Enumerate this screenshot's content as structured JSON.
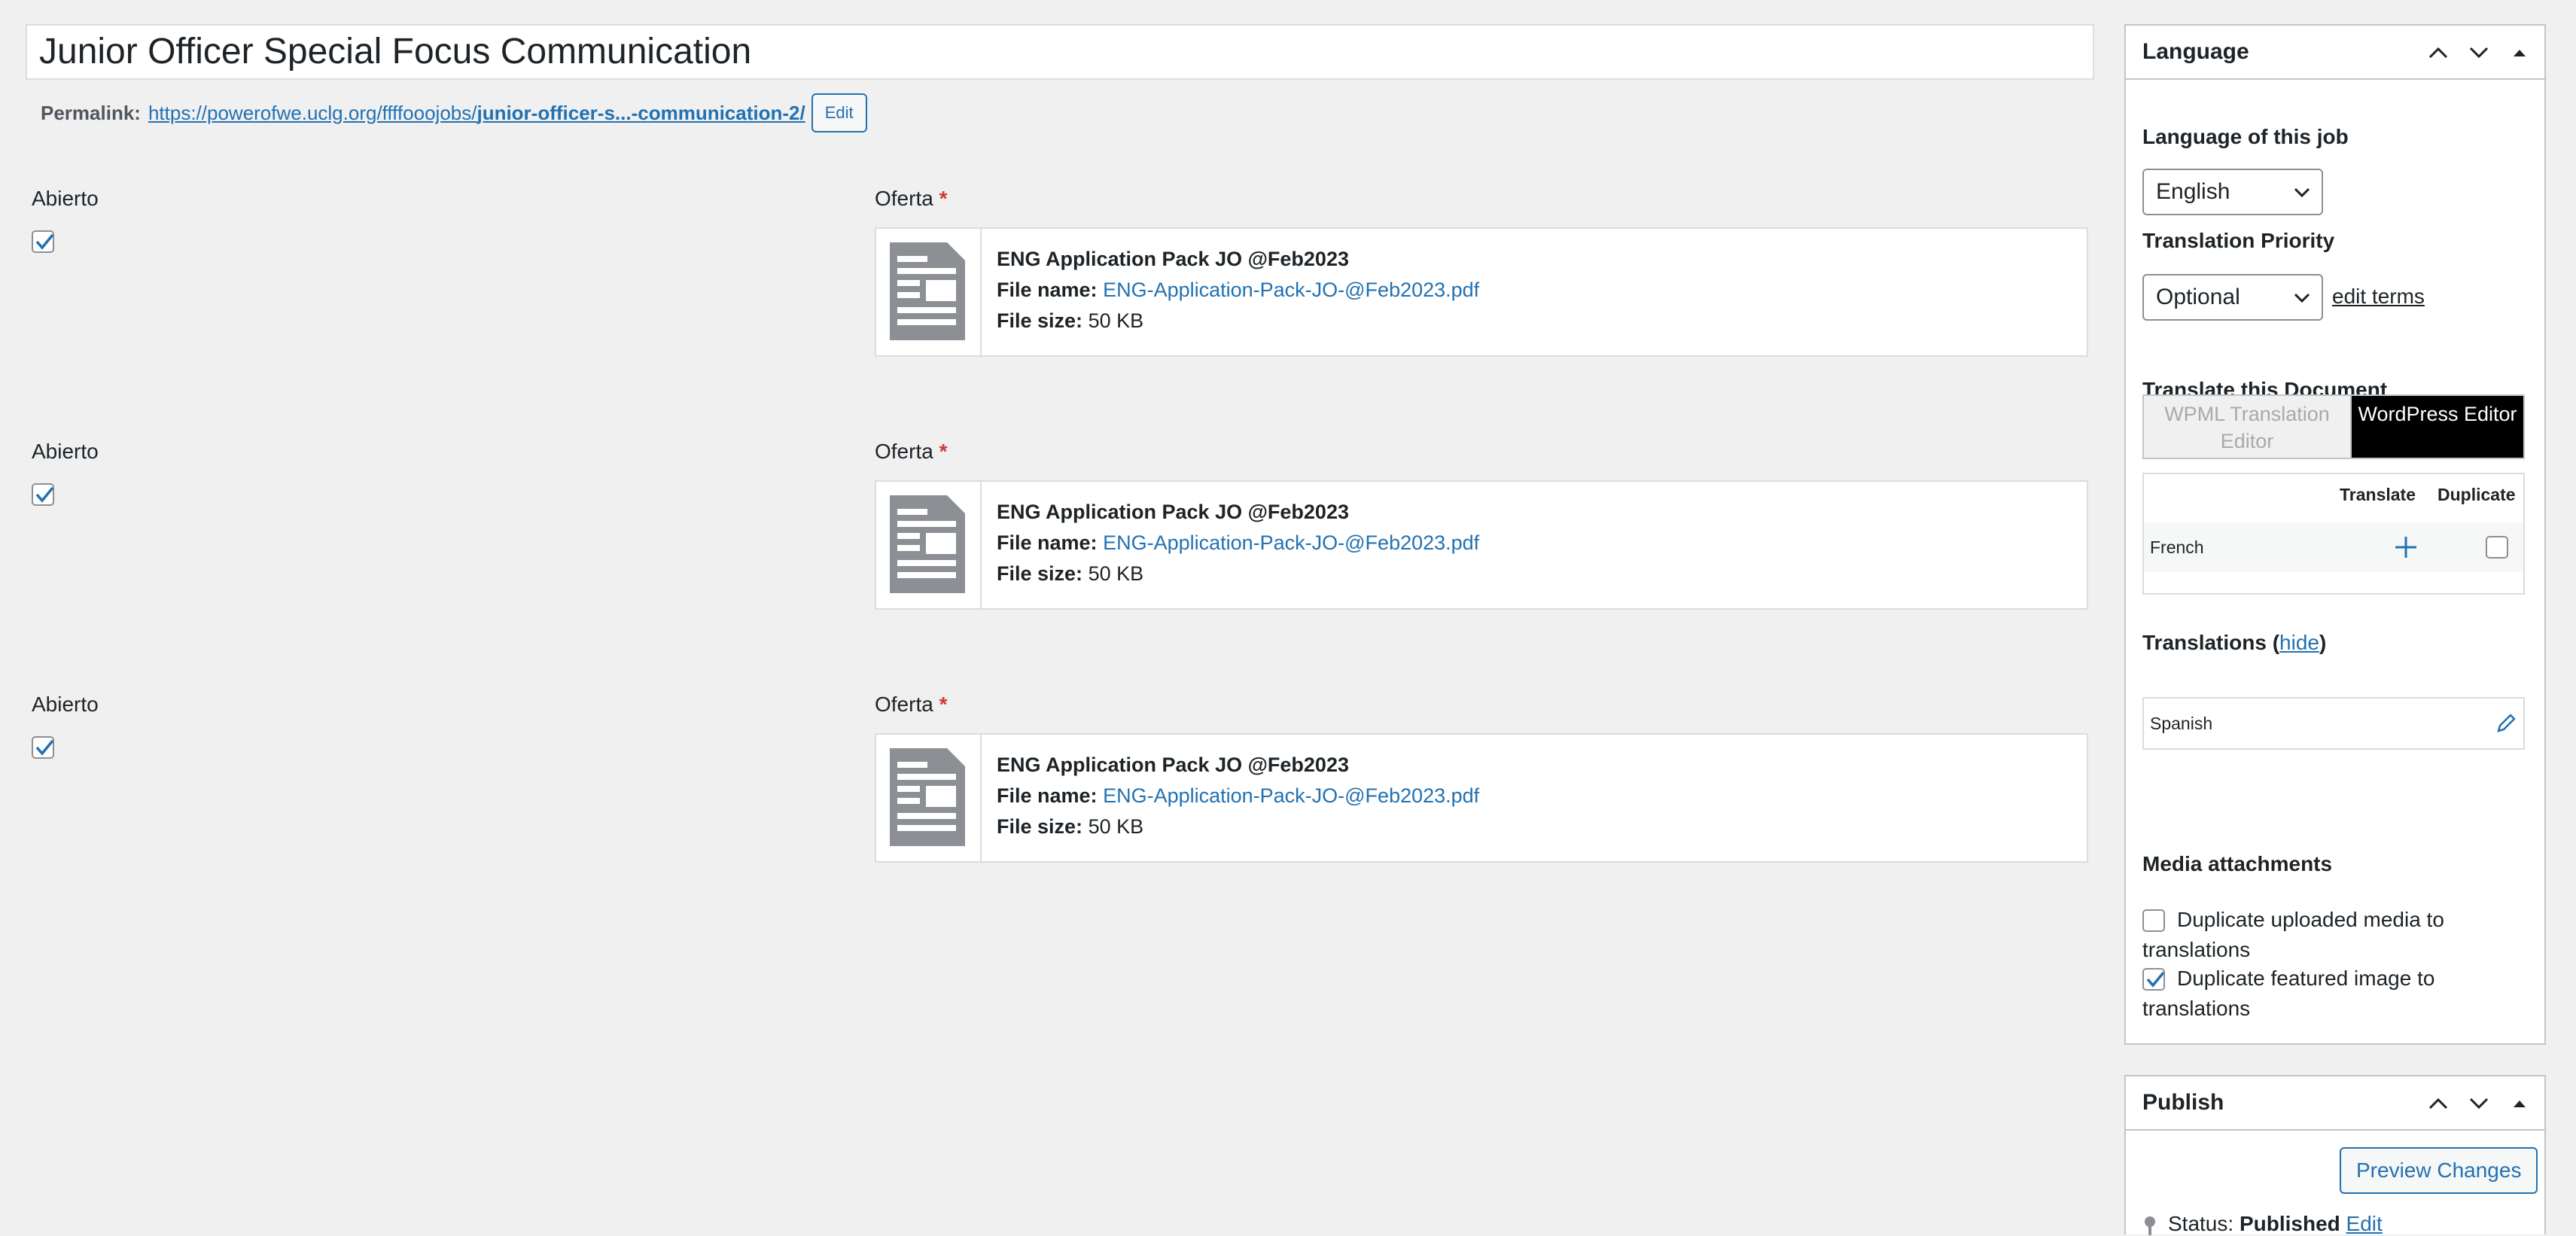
{
  "post": {
    "title": "Junior Officer Special Focus Communication",
    "permalink_label": "Permalink:",
    "permalink_base": "https://powerofwe.uclg.org/ffffooojobs/",
    "permalink_slug": "junior-officer-s...-communication-2/",
    "edit_button": "Edit"
  },
  "rows": [
    {
      "checkbox_label": "Abierto",
      "checked": true,
      "file_label": "Oferta",
      "required_mark": "*",
      "file_title": "ENG Application Pack JO @Feb2023",
      "file_name_label": "File name:",
      "file_name": "ENG-Application-Pack-JO-@Feb2023.pdf",
      "file_size_label": "File size:",
      "file_size": "50 KB"
    },
    {
      "checkbox_label": "Abierto",
      "checked": true,
      "file_label": "Oferta",
      "required_mark": "*",
      "file_title": "ENG Application Pack JO @Feb2023",
      "file_name_label": "File name:",
      "file_name": "ENG-Application-Pack-JO-@Feb2023.pdf",
      "file_size_label": "File size:",
      "file_size": "50 KB"
    },
    {
      "checkbox_label": "Abierto",
      "checked": true,
      "file_label": "Oferta",
      "required_mark": "*",
      "file_title": "ENG Application Pack JO @Feb2023",
      "file_name_label": "File name:",
      "file_name": "ENG-Application-Pack-JO-@Feb2023.pdf",
      "file_size_label": "File size:",
      "file_size": "50 KB"
    }
  ],
  "language_box": {
    "title": "Language",
    "language_of_job_label": "Language of this job",
    "language_value": "English",
    "priority_label": "Translation Priority",
    "priority_value": "Optional",
    "edit_terms": "edit terms",
    "translate_doc_label": "Translate this Document",
    "option_wpml": "WPML Translation Editor",
    "option_wp": "WordPress Editor",
    "col_translate": "Translate",
    "col_duplicate": "Duplicate",
    "target_language": "French",
    "translations_label": "Translations (",
    "translations_hide": "hide",
    "translations_close": ")",
    "existing_translation": "Spanish",
    "media_label": "Media attachments",
    "dup_media": "Duplicate uploaded media to translations",
    "dup_media_checked": false,
    "dup_featured": "Duplicate featured image to translations",
    "dup_featured_checked": true
  },
  "publish_box": {
    "title": "Publish",
    "preview_button": "Preview Changes",
    "status_label": "Status:",
    "status_value": "Published",
    "status_edit": "Edit"
  },
  "colors": {
    "link": "#2271b1",
    "required": "#d63638",
    "background": "#f0f0f1",
    "active_segment": "#000000"
  }
}
